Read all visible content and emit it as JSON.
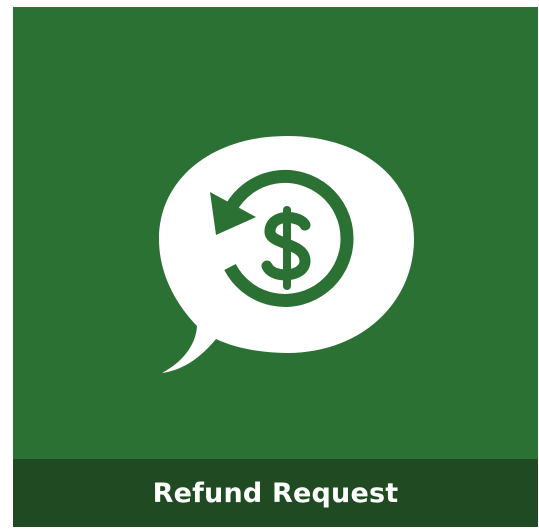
{
  "tile": {
    "label": "Refund Request",
    "icon": "refund-request-icon",
    "colors": {
      "background": "#2b7134",
      "caption_background": "#1f4a22",
      "icon_fill": "#ffffff",
      "label_text": "#ffffff"
    }
  }
}
